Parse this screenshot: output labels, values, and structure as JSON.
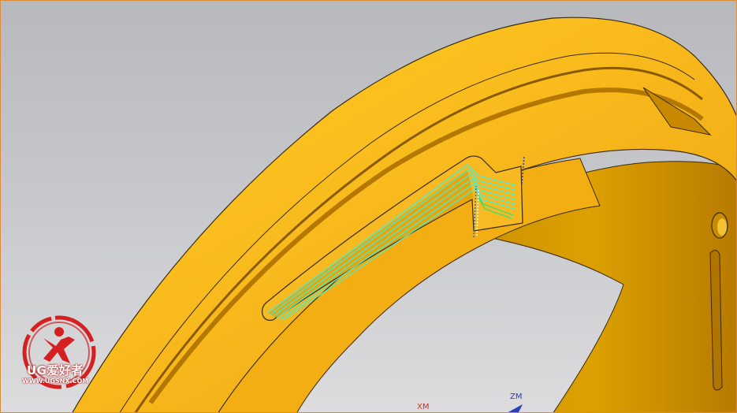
{
  "viewport": {
    "background_top": "#b8b9bd",
    "background_bottom": "#dcdcde"
  },
  "model": {
    "face_color": "#f7b61f",
    "highlight_color": "#ffd21e",
    "wall_color": "#d49800",
    "edge_color": "#3a2a10"
  },
  "toolpath": {
    "color": "#40f0d8",
    "engage_color": "#1a6fd0"
  },
  "axes": {
    "x_label": "XM",
    "z_label": "ZM",
    "x_color": "#c8322a",
    "z_color": "#2a3fb8"
  },
  "watermark": {
    "brand": "UG爱好者",
    "url": "WWW.UGSNX.COM",
    "color": "#d42020"
  }
}
